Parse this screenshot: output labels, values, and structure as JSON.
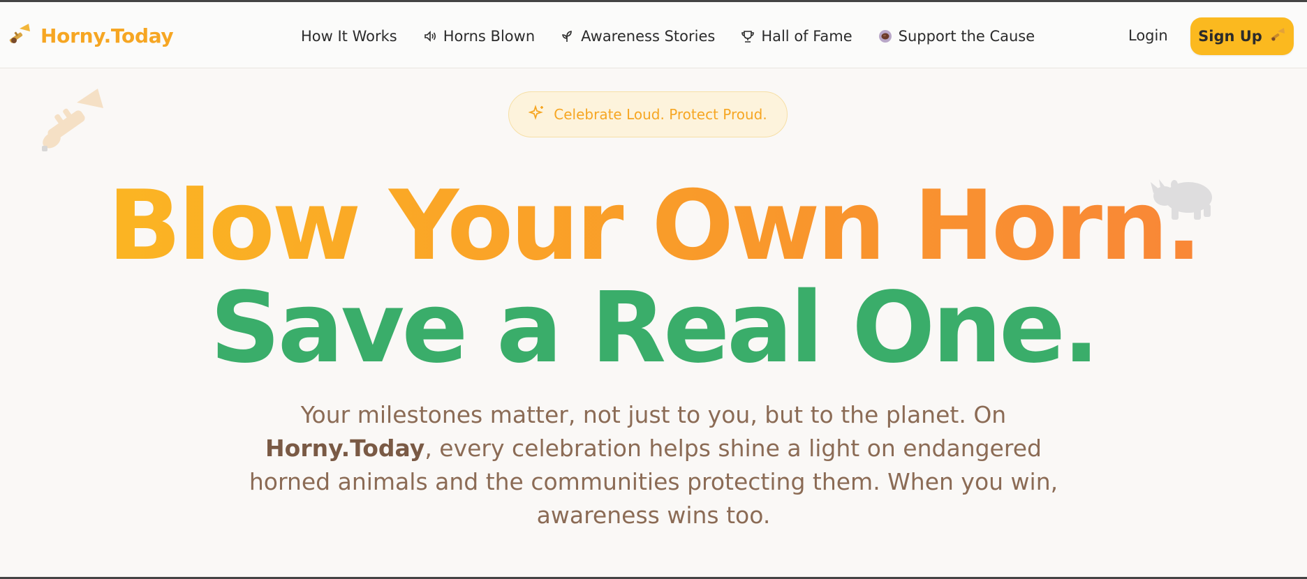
{
  "brand": {
    "name": "Horny.Today",
    "logo_icon": "trumpet-icon"
  },
  "nav": {
    "items": [
      {
        "label": "How It Works",
        "icon": ""
      },
      {
        "label": "Horns Blown",
        "icon": "speaker-icon"
      },
      {
        "label": "Awareness Stories",
        "icon": "sprout-icon"
      },
      {
        "label": "Hall of Fame",
        "icon": "trophy-icon"
      },
      {
        "label": "Support the Cause",
        "icon": "coffee-cup-icon"
      }
    ],
    "login_label": "Login",
    "signup_label": "Sign Up",
    "signup_icon": "trumpet-icon"
  },
  "hero": {
    "tagline": "Celebrate Loud. Protect Proud.",
    "tagline_icon": "sparkle-icon",
    "headline_line1": "Blow Your Own Horn.",
    "headline_line2": "Save a Real One.",
    "description_pre": "Your milestones matter, not just to you, but to the planet. On ",
    "description_brand": "Horny.Today",
    "description_post": ", every celebration helps shine a light on endangered horned animals and the communities protecting them. When you win, awareness wins too."
  },
  "colors": {
    "accent_yellow": "#fbb91f",
    "headline_orange_start": "#fbb523",
    "headline_orange_end": "#f98737",
    "headline_green": "#3aad6a",
    "body_text": "#8b6b55",
    "background": "#faf8f6"
  }
}
